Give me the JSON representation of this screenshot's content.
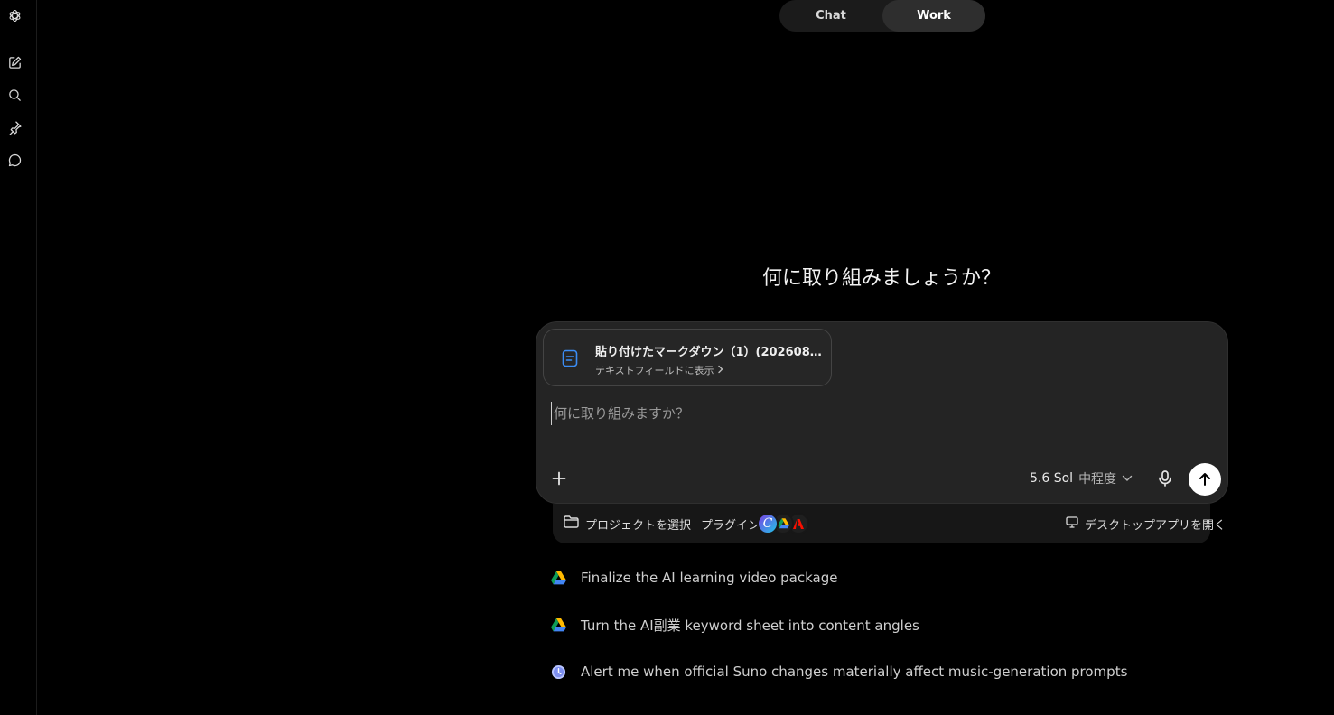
{
  "mode_toggle": {
    "tabs": [
      {
        "label": "Chat",
        "active": false
      },
      {
        "label": "Work",
        "active": true
      }
    ]
  },
  "sidebar": {
    "icons": [
      "openai-logo-icon",
      "new-chat-icon",
      "search-icon",
      "pin-icon",
      "chat-bubble-icon"
    ]
  },
  "main": {
    "heading": "何に取り組みましょうか？"
  },
  "composer": {
    "attachment": {
      "title": "貼り付けたマークダウン（1）(20260807-0...",
      "subtitle": "テキストフィールドに表示",
      "icon": "document-icon"
    },
    "input_placeholder": "何に取り組みますか？",
    "input_value": "",
    "model": "5.6 Sol",
    "effort": "中程度",
    "accent": "#3b8df5"
  },
  "toolbar": {
    "project_label": "プロジェクトを選択",
    "plugin_label": "プラグイン",
    "desktop_label": "デスクトップアプリを開く",
    "plugin_badges": [
      "C"
    ]
  },
  "suggestions": [
    {
      "text": "Finalize the AI learning video package",
      "icon": "google-drive-icon"
    },
    {
      "text": "Turn the AI副業 keyword sheet into content angles",
      "icon": "google-drive-icon"
    },
    {
      "text": "Alert me when official Suno changes materially affect music-generation prompts",
      "icon": "clock-icon"
    }
  ]
}
